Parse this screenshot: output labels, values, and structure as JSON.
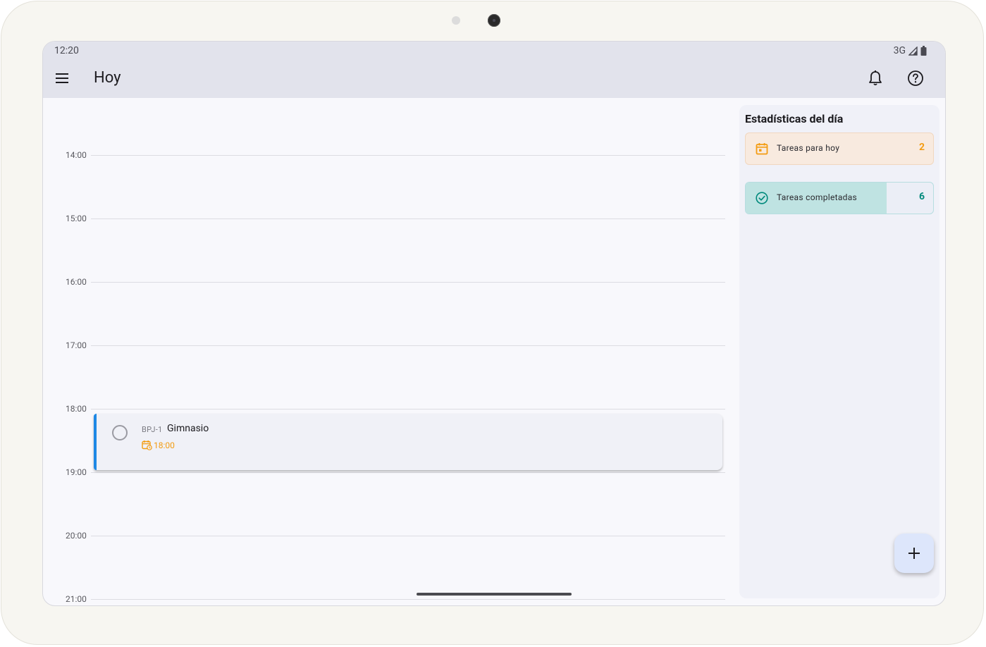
{
  "status_bar": {
    "time": "12:20",
    "network": "3G"
  },
  "app_bar": {
    "title": "Hoy"
  },
  "timeline": {
    "hours": [
      "14:00",
      "15:00",
      "16:00",
      "17:00",
      "18:00",
      "19:00",
      "20:00",
      "21:00"
    ],
    "task": {
      "id": "BPJ-1",
      "title": "Gimnasio",
      "time": "18:00",
      "accent_color": "#1e88e5",
      "time_color": "#f39c12"
    }
  },
  "stats": {
    "title": "Estadísticas del día",
    "today": {
      "label": "Tareas para hoy",
      "count": "2",
      "color": "#f39c12"
    },
    "completed": {
      "label": "Tareas completadas",
      "count": "6",
      "color": "#00897b",
      "fill_fraction": 0.75
    }
  },
  "icons": {
    "menu": "menu-icon",
    "bell": "bell-icon",
    "help": "help-icon",
    "calendar": "calendar-icon",
    "check_circle": "check-circle-icon",
    "add": "plus-icon"
  }
}
